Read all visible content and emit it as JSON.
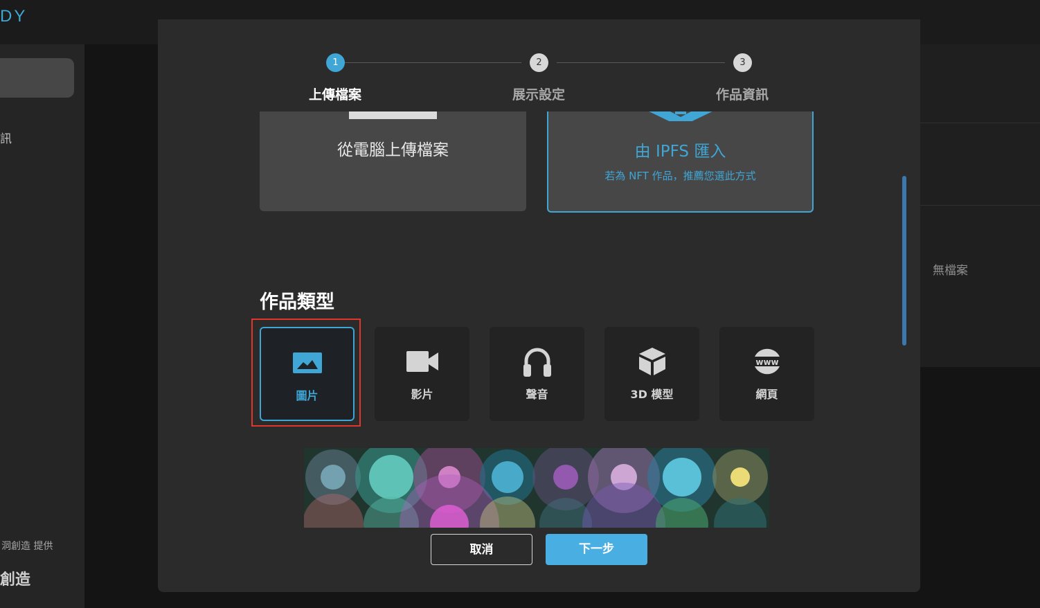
{
  "app": {
    "brand_fragment": "DY",
    "sidebar_info": "訊",
    "provider_text": "洞創造 提供",
    "brand_bottom": "創造",
    "right_panel_empty": "無檔案"
  },
  "modal": {
    "close_glyph": "✕",
    "steps": [
      {
        "number": "1",
        "label": "上傳檔案",
        "active": true
      },
      {
        "number": "2",
        "label": "展示設定",
        "active": false
      },
      {
        "number": "3",
        "label": "作品資訊",
        "active": false
      }
    ],
    "upload_sources": {
      "computer": {
        "title": "從電腦上傳檔案",
        "icon": "laptop-icon"
      },
      "ipfs": {
        "title": "由 IPFS 匯入",
        "subtitle": "若為 NFT 作品，推薦您選此方式",
        "icon": "ipfs-download-icon",
        "selected": true
      }
    },
    "work_type": {
      "title": "作品類型",
      "types": [
        {
          "label": "圖片",
          "icon": "image-icon",
          "selected": true
        },
        {
          "label": "影片",
          "icon": "video-camera-icon",
          "selected": false
        },
        {
          "label": "聲音",
          "icon": "headphones-icon",
          "selected": false
        },
        {
          "label": "3D 模型",
          "icon": "cube-icon",
          "selected": false
        },
        {
          "label": "網頁",
          "icon": "www-globe-icon",
          "selected": false
        }
      ]
    },
    "buttons": {
      "cancel": "取消",
      "next": "下一步"
    }
  },
  "colors": {
    "accent": "#3fa6d6",
    "button_primary": "#49aee2",
    "highlight": "#e0362c",
    "modal_bg": "#2b2b2b"
  }
}
